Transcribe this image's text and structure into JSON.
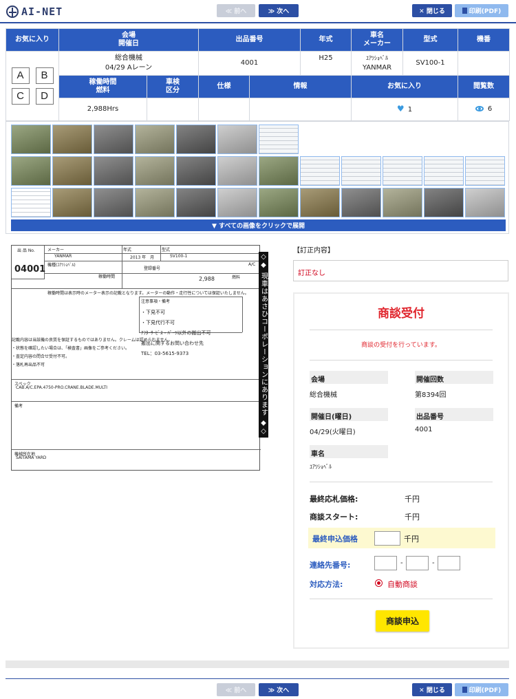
{
  "header": {
    "logo_text": "AI-NET",
    "prev_label": "≪ 前へ",
    "next_label": "≫ 次へ",
    "close_label": "✕ 閉じる",
    "print_label": "印刷(PDF)"
  },
  "info": {
    "headers1": [
      "お気に入り",
      "会場\n開催日",
      "出品番号",
      "年式",
      "車名\nメーカー",
      "型式",
      "機番"
    ],
    "venue": "総合機械",
    "date_lane": "04/29 Aレーン",
    "lot_no": "4001",
    "year": "H25",
    "car_name": "ﾕｱﾂｼｮﾍﾞﾙ",
    "maker": "YANMAR",
    "model": "SV100-1",
    "serial": "",
    "favorites": [
      "A",
      "B",
      "C",
      "D"
    ],
    "headers2": [
      "稼働時間\n燃料",
      "車検\n区分",
      "仕様",
      "情報",
      "お気に入り",
      "閲覧数"
    ],
    "hours": "2,988Hrs",
    "fav_count": "1",
    "view_count": "6"
  },
  "gallery": {
    "expand_label": "▼ すべての画像をクリックで展開"
  },
  "sheet": {
    "lot_label": "出 品 No.",
    "lot_value": "04001",
    "maker_label": "メーカー",
    "maker_value": "YANMAR",
    "year_label": "年式",
    "year_value": "2013 年　月",
    "model_label": "型式",
    "model_value": "SV100-1",
    "car_label": "機種(ﾕｱﾂｼｮﾍﾞﾙ)",
    "serial_label": "登録番号",
    "ac_label": "A/C",
    "hours_label": "稼働時間",
    "hours_value": "2,988",
    "fuel_label": "燃料",
    "notice_label": "注意事項・備考",
    "notes": [
      "・下見不可",
      "・下見代行不可",
      "ｱﾌﾀｰｻｰﾋﾞｽ・ﾊﾟｰﾂ以外の搬出不可",
      "搬出に関するお問い合わせ先",
      "TEL：03-5615-9373"
    ],
    "meter_note": "稼働時間は表示時のメーター表示の記載となります。メーターの動作・走行性については保証いたしません。",
    "warranty": "記載内容は当該機の良質を保証するものではありません。クレームは認められません。",
    "bullets": [
      "・状態を確認したい場合は、「検査書」画像をご参考ください。",
      "・査定内容の問合せ受付不可。",
      "・落札再出品不可"
    ],
    "spec_label": "スペック",
    "spec_value": "CAB.A/C.EPA.4750-PRO.CRANE.BLADE.MULTI",
    "remarks_label": "備考",
    "location_label": "機械所在地",
    "location_value": "SAITAMA YARD",
    "banner": "◇◆ 現車はあさひコーポレーションにあります ◆◇"
  },
  "correction": {
    "title": "【訂正内容】",
    "value": "訂正なし"
  },
  "negotiation": {
    "title": "商談受付",
    "message": "商談の受付を行っています。",
    "venue_label": "会場",
    "venue_value": "総合機械",
    "round_label": "開催回数",
    "round_value": "第8394回",
    "date_label": "開催日(曜日)",
    "date_value": "04/29(火曜日)",
    "lot_label": "出品番号",
    "lot_value": "4001",
    "car_label": "車名",
    "car_value": "ﾕｱﾂｼｮﾍﾞﾙ",
    "last_bid_label": "最終応札価格:",
    "last_bid_value": "千円",
    "start_label": "商談スタート:",
    "start_value": "千円",
    "final_offer_label": "最終申込価格",
    "final_offer_unit": "千円",
    "contact_label": "連絡先番号:",
    "method_label": "対応方法:",
    "method_value": "自動商談",
    "submit_label": "商談申込"
  }
}
